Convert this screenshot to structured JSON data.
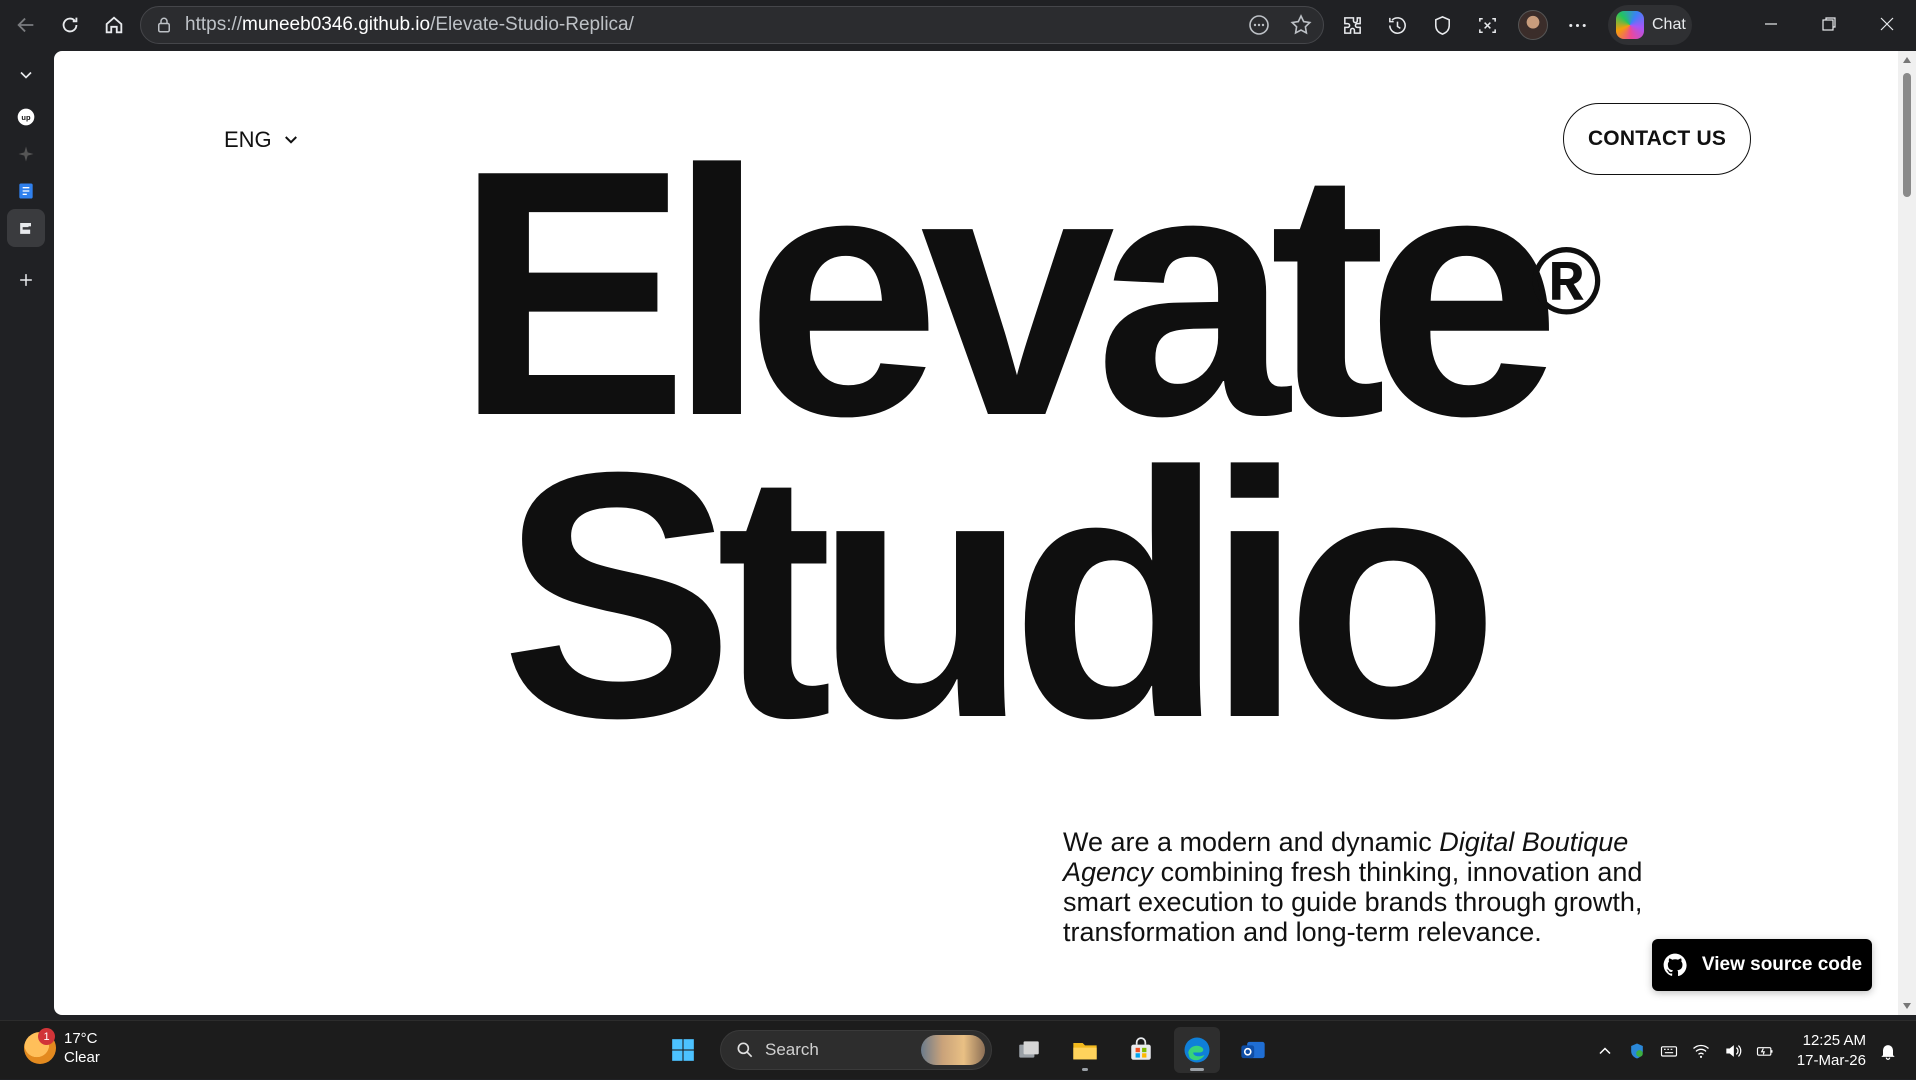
{
  "browser": {
    "url_prefix": "https://",
    "url_host": "muneeb0346.github.io",
    "url_path": "/Elevate-Studio-Replica/",
    "chat_label": "Chat"
  },
  "page": {
    "language": "ENG",
    "contact_label": "CONTACT US",
    "hero_line1": "Elevate",
    "hero_line2": "Studio",
    "registered_mark": "®",
    "tagline_start": "We are a modern and dynamic ",
    "tagline_emphasis": "Digital Boutique Agency",
    "tagline_end": " combining fresh thinking, innovation and smart execution to guide brands through growth, transformation and long-term relevance.",
    "source_button_label": "View source code"
  },
  "taskbar": {
    "temperature": "17°C",
    "weather_condition": "Clear",
    "weather_badge": "1",
    "search_placeholder": "Search",
    "time": "12:25 AM",
    "date": "17-Mar-26"
  },
  "colors": {
    "page_background": "#ffffff",
    "text_primary": "#0f0f0f",
    "chrome_background": "#202124",
    "taskbar_background": "#1c1c1c"
  }
}
